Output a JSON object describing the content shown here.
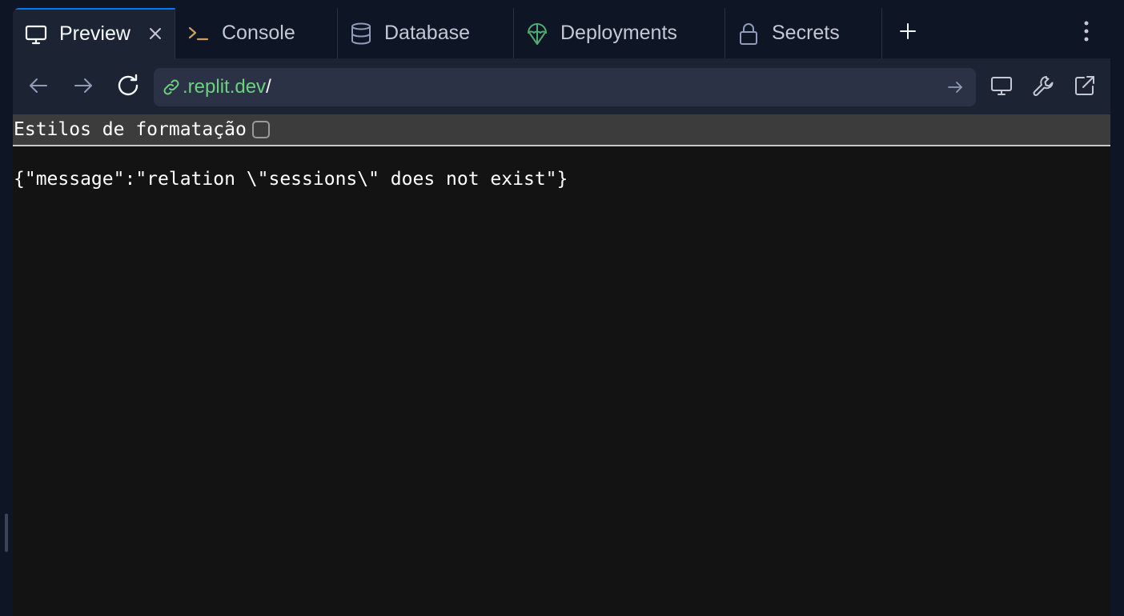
{
  "tabs": [
    {
      "label": "Preview",
      "icon": "monitor-icon",
      "active": true
    },
    {
      "label": "Console",
      "icon": "terminal-icon",
      "active": false
    },
    {
      "label": "Database",
      "icon": "database-icon",
      "active": false
    },
    {
      "label": "Deployments",
      "icon": "deployments-icon",
      "active": false
    },
    {
      "label": "Secrets",
      "icon": "lock-icon",
      "active": false
    }
  ],
  "urlbar": {
    "host": ".replit.dev",
    "path": "/"
  },
  "format": {
    "label": "Estilos de formatação",
    "checked": false
  },
  "response": {
    "body": "{\"message\":\"relation \\\"sessions\\\" does not exist\"}"
  },
  "colors": {
    "accent": "#0079f2",
    "url_host": "#6bd17f",
    "deploy_icon": "#4fae6f",
    "console_icon": "#c9a35b"
  }
}
